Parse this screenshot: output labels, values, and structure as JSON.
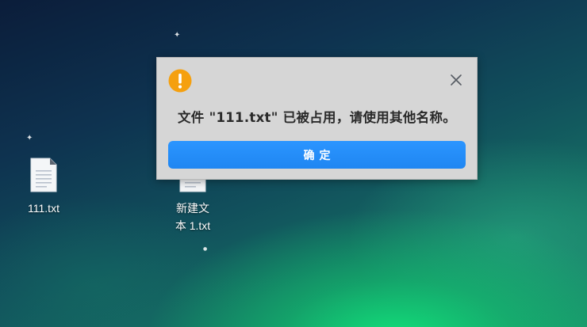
{
  "desktop": {
    "icons": [
      {
        "label": "111.txt"
      },
      {
        "label": "新建文本 1.txt"
      }
    ]
  },
  "dialog": {
    "message": "文件 \"111.txt\" 已被占用，请使用其他名称。",
    "ok_label": "确定",
    "warning_icon": "exclamation-icon",
    "close_icon": "close-icon",
    "accent_color": "#1f86f2",
    "warning_color": "#f5a00f"
  }
}
